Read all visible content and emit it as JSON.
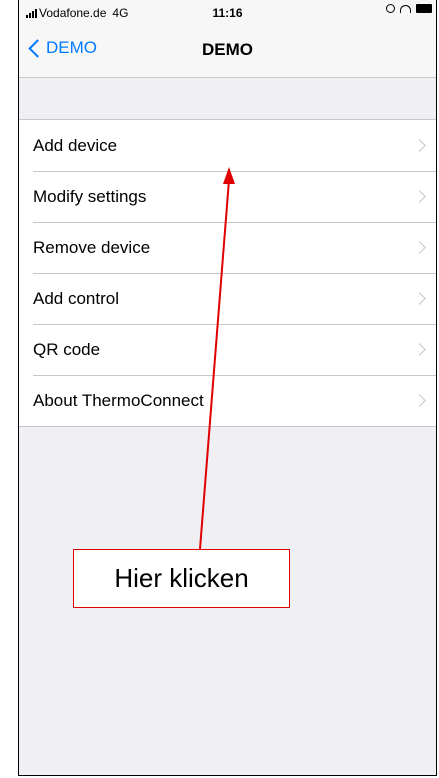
{
  "status_bar": {
    "carrier": "Vodafone.de",
    "network": "4G",
    "time": "11:16",
    "icons": [
      "signal-icon",
      "location-icon",
      "headphones-icon",
      "battery-icon"
    ]
  },
  "nav": {
    "back_label": "DEMO",
    "title": "DEMO"
  },
  "menu": {
    "items": [
      {
        "label": "Add device"
      },
      {
        "label": "Modify settings"
      },
      {
        "label": "Remove device"
      },
      {
        "label": "Add control"
      },
      {
        "label": "QR code"
      },
      {
        "label": "About ThermoConnect"
      }
    ]
  },
  "annotation": {
    "callout_text": "Hier klicken",
    "color": "#e00000"
  },
  "colors": {
    "accent": "#007aff",
    "background": "#efeff4",
    "separator": "#c8c7cc"
  }
}
